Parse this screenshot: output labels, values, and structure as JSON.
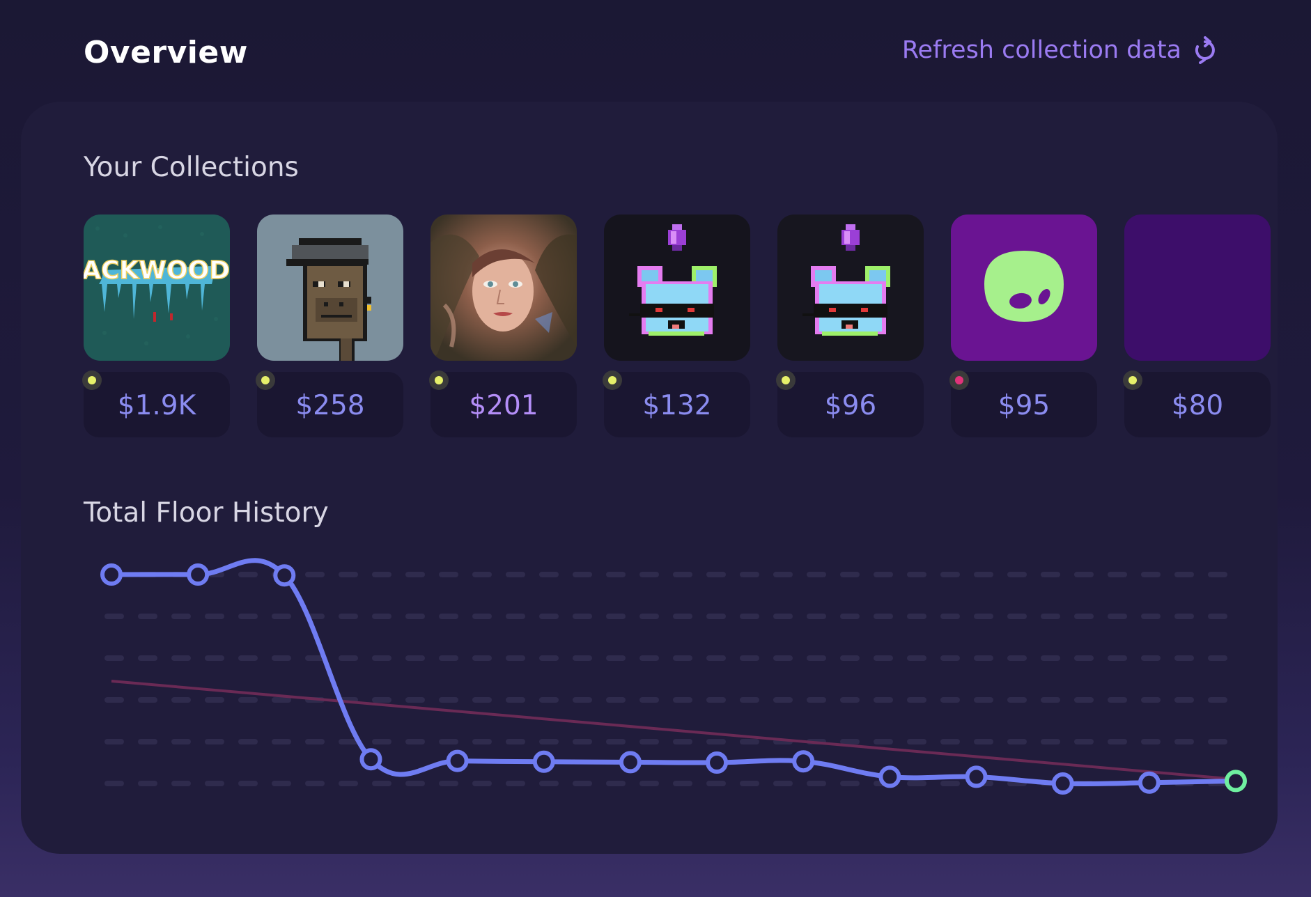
{
  "header": {
    "title": "Overview",
    "refresh_label": "Refresh collection data",
    "refresh_icon": "refresh-icon"
  },
  "collections_section": {
    "title": "Your Collections",
    "items": [
      {
        "name": "PACKWOODS",
        "price": "$1.9K",
        "status_color": "#e6f06a",
        "thumb": "packwoods-logo"
      },
      {
        "name": "",
        "price": "$258",
        "status_color": "#e6f06a",
        "thumb": "pixel-ape"
      },
      {
        "name": "",
        "price": "$201",
        "status_color": "#e6f06a",
        "thumb": "painted-portrait",
        "highlighted": true
      },
      {
        "name": "",
        "price": "$132",
        "status_color": "#e6f06a",
        "thumb": "pixel-cat-gem"
      },
      {
        "name": "",
        "price": "$96",
        "status_color": "#e6f06a",
        "thumb": "pixel-cat-gem"
      },
      {
        "name": "",
        "price": "$95",
        "status_color": "#e0337a",
        "thumb": "alien-head"
      },
      {
        "name": "",
        "price": "$80",
        "status_color": "#e6f06a",
        "thumb": "purple-square"
      }
    ]
  },
  "history_section": {
    "title": "Total Floor History"
  },
  "chart_data": {
    "type": "line",
    "title": "Total Floor History",
    "xlabel": "",
    "ylabel": "",
    "grid": true,
    "legend": "none",
    "x": [
      1,
      2,
      3,
      4,
      5,
      6,
      7,
      8,
      9,
      10,
      11,
      12,
      13,
      14
    ],
    "series": [
      {
        "values": [
          5.0,
          5.0,
          4.98,
          0.58,
          0.54,
          0.52,
          0.51,
          0.5,
          0.53,
          0.16,
          0.16,
          0.0,
          0.02,
          0.06
        ],
        "color": "#6f7cf2"
      }
    ],
    "trend_line": {
      "start": 2.45,
      "end": 0.1,
      "color": "#6a2a55"
    },
    "ylim": [
      0,
      5
    ],
    "colors": {
      "line": "#6f7cf2",
      "last_point": "#6ff0a0",
      "grid": "#2f2b4d"
    }
  }
}
